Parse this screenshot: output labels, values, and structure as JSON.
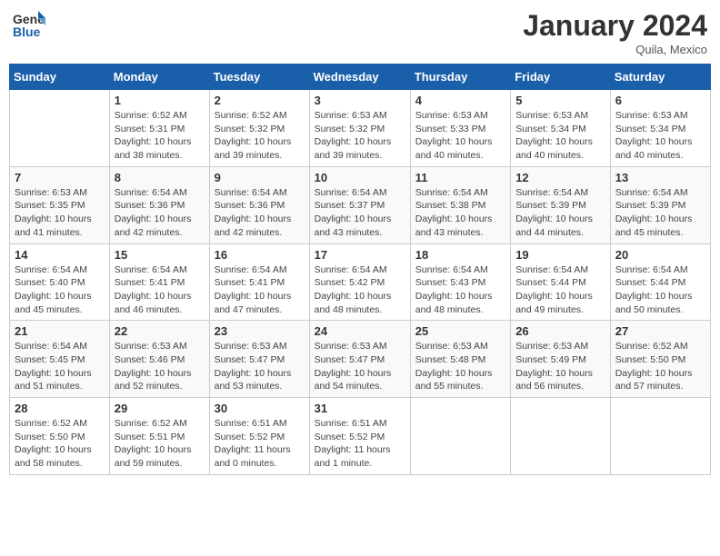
{
  "header": {
    "logo_general": "General",
    "logo_blue": "Blue",
    "month_title": "January 2024",
    "location": "Quila, Mexico"
  },
  "days_of_week": [
    "Sunday",
    "Monday",
    "Tuesday",
    "Wednesday",
    "Thursday",
    "Friday",
    "Saturday"
  ],
  "weeks": [
    [
      {
        "day": "",
        "info": ""
      },
      {
        "day": "1",
        "info": "Sunrise: 6:52 AM\nSunset: 5:31 PM\nDaylight: 10 hours\nand 38 minutes."
      },
      {
        "day": "2",
        "info": "Sunrise: 6:52 AM\nSunset: 5:32 PM\nDaylight: 10 hours\nand 39 minutes."
      },
      {
        "day": "3",
        "info": "Sunrise: 6:53 AM\nSunset: 5:32 PM\nDaylight: 10 hours\nand 39 minutes."
      },
      {
        "day": "4",
        "info": "Sunrise: 6:53 AM\nSunset: 5:33 PM\nDaylight: 10 hours\nand 40 minutes."
      },
      {
        "day": "5",
        "info": "Sunrise: 6:53 AM\nSunset: 5:34 PM\nDaylight: 10 hours\nand 40 minutes."
      },
      {
        "day": "6",
        "info": "Sunrise: 6:53 AM\nSunset: 5:34 PM\nDaylight: 10 hours\nand 40 minutes."
      }
    ],
    [
      {
        "day": "7",
        "info": "Sunrise: 6:53 AM\nSunset: 5:35 PM\nDaylight: 10 hours\nand 41 minutes."
      },
      {
        "day": "8",
        "info": "Sunrise: 6:54 AM\nSunset: 5:36 PM\nDaylight: 10 hours\nand 42 minutes."
      },
      {
        "day": "9",
        "info": "Sunrise: 6:54 AM\nSunset: 5:36 PM\nDaylight: 10 hours\nand 42 minutes."
      },
      {
        "day": "10",
        "info": "Sunrise: 6:54 AM\nSunset: 5:37 PM\nDaylight: 10 hours\nand 43 minutes."
      },
      {
        "day": "11",
        "info": "Sunrise: 6:54 AM\nSunset: 5:38 PM\nDaylight: 10 hours\nand 43 minutes."
      },
      {
        "day": "12",
        "info": "Sunrise: 6:54 AM\nSunset: 5:39 PM\nDaylight: 10 hours\nand 44 minutes."
      },
      {
        "day": "13",
        "info": "Sunrise: 6:54 AM\nSunset: 5:39 PM\nDaylight: 10 hours\nand 45 minutes."
      }
    ],
    [
      {
        "day": "14",
        "info": "Sunrise: 6:54 AM\nSunset: 5:40 PM\nDaylight: 10 hours\nand 45 minutes."
      },
      {
        "day": "15",
        "info": "Sunrise: 6:54 AM\nSunset: 5:41 PM\nDaylight: 10 hours\nand 46 minutes."
      },
      {
        "day": "16",
        "info": "Sunrise: 6:54 AM\nSunset: 5:41 PM\nDaylight: 10 hours\nand 47 minutes."
      },
      {
        "day": "17",
        "info": "Sunrise: 6:54 AM\nSunset: 5:42 PM\nDaylight: 10 hours\nand 48 minutes."
      },
      {
        "day": "18",
        "info": "Sunrise: 6:54 AM\nSunset: 5:43 PM\nDaylight: 10 hours\nand 48 minutes."
      },
      {
        "day": "19",
        "info": "Sunrise: 6:54 AM\nSunset: 5:44 PM\nDaylight: 10 hours\nand 49 minutes."
      },
      {
        "day": "20",
        "info": "Sunrise: 6:54 AM\nSunset: 5:44 PM\nDaylight: 10 hours\nand 50 minutes."
      }
    ],
    [
      {
        "day": "21",
        "info": "Sunrise: 6:54 AM\nSunset: 5:45 PM\nDaylight: 10 hours\nand 51 minutes."
      },
      {
        "day": "22",
        "info": "Sunrise: 6:53 AM\nSunset: 5:46 PM\nDaylight: 10 hours\nand 52 minutes."
      },
      {
        "day": "23",
        "info": "Sunrise: 6:53 AM\nSunset: 5:47 PM\nDaylight: 10 hours\nand 53 minutes."
      },
      {
        "day": "24",
        "info": "Sunrise: 6:53 AM\nSunset: 5:47 PM\nDaylight: 10 hours\nand 54 minutes."
      },
      {
        "day": "25",
        "info": "Sunrise: 6:53 AM\nSunset: 5:48 PM\nDaylight: 10 hours\nand 55 minutes."
      },
      {
        "day": "26",
        "info": "Sunrise: 6:53 AM\nSunset: 5:49 PM\nDaylight: 10 hours\nand 56 minutes."
      },
      {
        "day": "27",
        "info": "Sunrise: 6:52 AM\nSunset: 5:50 PM\nDaylight: 10 hours\nand 57 minutes."
      }
    ],
    [
      {
        "day": "28",
        "info": "Sunrise: 6:52 AM\nSunset: 5:50 PM\nDaylight: 10 hours\nand 58 minutes."
      },
      {
        "day": "29",
        "info": "Sunrise: 6:52 AM\nSunset: 5:51 PM\nDaylight: 10 hours\nand 59 minutes."
      },
      {
        "day": "30",
        "info": "Sunrise: 6:51 AM\nSunset: 5:52 PM\nDaylight: 11 hours\nand 0 minutes."
      },
      {
        "day": "31",
        "info": "Sunrise: 6:51 AM\nSunset: 5:52 PM\nDaylight: 11 hours\nand 1 minute."
      },
      {
        "day": "",
        "info": ""
      },
      {
        "day": "",
        "info": ""
      },
      {
        "day": "",
        "info": ""
      }
    ]
  ]
}
